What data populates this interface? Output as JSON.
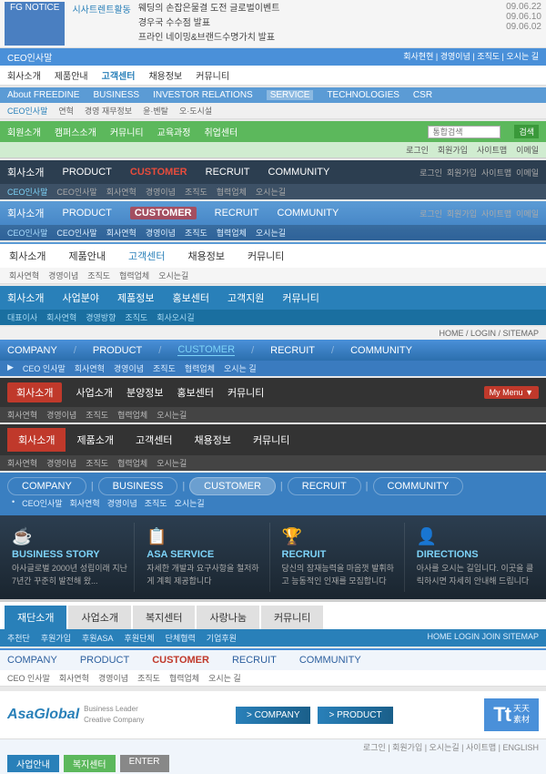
{
  "notice": {
    "label": "FG NOTICE",
    "link": "시사트렌트활동",
    "items": [
      {
        "text": "웨딩의 손잡은물결 도전 글로벌이벤트",
        "date": "09.06.22"
      },
      {
        "text": "경우국 수수점 발표",
        "date": "09.06.10"
      },
      {
        "text": "프라인 네이밍&브랜드수명가치 발표",
        "date": "09.06.02"
      }
    ]
  },
  "nav1": {
    "label": "CEO인사말",
    "items": [
      "회사소개",
      "제품안내",
      "고객센터",
      "채용정보",
      "커뮤니티"
    ],
    "subitems": [
      "회사현현",
      "경영이념",
      "조직도",
      "오시는 길"
    ]
  },
  "nav2": {
    "label": "About FREEDINE",
    "items": [
      "BUSINESS",
      "INVESTOR RELATIONS",
      "SERVICE",
      "TECHNOLOGIES",
      "CSR"
    ],
    "subitems": [
      "연혁",
      "경영 재무정보",
      "윤·벤탈",
      "오·도시설"
    ]
  },
  "nav3": {
    "label": "CEO인사말",
    "items": [
      "회원소개",
      "캠퍼스소개",
      "커뮤니티",
      "교육과정",
      "취업센터"
    ],
    "searchPlaceholder": "통합검색",
    "subitems": [
      "로그인",
      "회원가입",
      "사이트맵",
      "이메일"
    ]
  },
  "nav4": {
    "items": [
      "회사소개",
      "PRODUCT",
      "CUSTOMER",
      "RECRUIT",
      "COMMUNITY"
    ],
    "subitems": [
      "CEO인사말",
      "회사연혁",
      "경영이념",
      "조직도",
      "협력업체",
      "오시는길"
    ],
    "rightItems": [
      "로그인",
      "회원가입",
      "사이트맵",
      "이메일"
    ]
  },
  "nav5": {
    "items": [
      "회사소개",
      "PRODUCT",
      "CUSTOMER",
      "RECRUIT",
      "COMMUNITY"
    ],
    "subitems": [
      "CEO인사말",
      "회사연혁",
      "경영이념",
      "조직도",
      "협력업체",
      "오시는길"
    ],
    "rightItems": [
      "로그인",
      "회원가입",
      "사이트맵",
      "이메일"
    ]
  },
  "nav6": {
    "items": [
      "회사소개",
      "제품안내",
      "고객센터",
      "채용정보",
      "커뮤니티"
    ],
    "subitems": [
      "회사연혁",
      "경영이념",
      "조직도",
      "협력업체",
      "오시는길"
    ]
  },
  "nav7": {
    "items": [
      "회사소개",
      "사업분야",
      "제품정보",
      "홍보센터",
      "고객지원",
      "커뮤니티"
    ],
    "subitems": [
      "대표이사",
      "회사연혁",
      "경영방향",
      "조직도",
      "회사오시길"
    ]
  },
  "nav8": {
    "breadcrumb": "HOME / LOGIN / SITEMAP",
    "items": [
      "COMPANY",
      "PRODUCT",
      "CUSTOMER",
      "RECRUIT",
      "COMMUNITY"
    ],
    "subitems": [
      "CEO 인사말",
      "회사연혁",
      "경영이념",
      "조직도",
      "협력업체",
      "오시는 길"
    ]
  },
  "nav9": {
    "items": [
      "회사소개",
      "사업소개",
      "분양정보",
      "홍보센터",
      "커뮤니티"
    ],
    "subitems": [
      "회사연혁",
      "경영이념",
      "조직도",
      "협력업체",
      "오시는길"
    ],
    "myMenu": "My Menu ▼"
  },
  "nav10": {
    "items": [
      "회사소개",
      "제품소개",
      "고객센터",
      "채용정보",
      "커뮤니티"
    ],
    "subitems": [
      "회사연혁",
      "경영이념",
      "조직도",
      "협력업체",
      "오시는길"
    ],
    "activeItem": "회사소개"
  },
  "nav11": {
    "items": [
      "COMPANY",
      "BUSINESS",
      "CUSTOMER",
      "RECRUIT",
      "COMMUNITY"
    ],
    "subitems": [
      "CEO인사말",
      "회사연혁",
      "경영이념",
      "조직도",
      "오시는길"
    ]
  },
  "businessSection": {
    "cards": [
      {
        "icon": "☕",
        "title": "BUSINESS STORY",
        "content": "아사글로벌 2000년 성립이래 지난 7년간 꾸준히 발전해 왔..."
      },
      {
        "icon": "📋",
        "title": "ASA SERVICE",
        "content": "자세한 개발과 요구사항을 철저하게 계획 제공합니다"
      },
      {
        "icon": "🏆",
        "title": "RECRUIT",
        "content": "당신의 잠재능력을 마음껏 발휘하고 능동적인 인재를 모집합니다"
      },
      {
        "icon": "👤",
        "title": "DIRECTIONS",
        "content": "아사를 오시는 길입니다. 이곳을 클릭하시면 자세히 안내해 드립니다"
      }
    ]
  },
  "nav12": {
    "items": [
      "재단소개",
      "사업소개",
      "복지센터",
      "사랑나눔",
      "커뮤니티"
    ],
    "subitems": [
      "추천단",
      "후원가입",
      "후원ASA",
      "후원단체",
      "단체협력",
      "기업후원"
    ],
    "breadcrumb": "HOME  LOGIN  JOIN  SITEMAP"
  },
  "nav13": {
    "items": [
      "COMPANY",
      "PRODUCT",
      "CUSTOMER",
      "RECRUIT",
      "COMMUNITY"
    ],
    "subitems": [
      "CEO 인사말",
      "회사연혁",
      "경영이념",
      "조직도",
      "협력업체",
      "오시는 길"
    ]
  },
  "asaGlobal": {
    "logo": "AsaGlobal",
    "tagline1": "Business Leader",
    "tagline2": "Creative Company",
    "navItems": [
      "> COMPANY",
      "> PRODUCT"
    ],
    "loginBar": "로그인 | 회원가입 | 오시는길 | 사이트맵 | ENGLISH",
    "subnav": [
      "사업안내",
      "복지센터",
      "ENTER"
    ]
  },
  "watermark": "天天素材 ttsucai.com"
}
